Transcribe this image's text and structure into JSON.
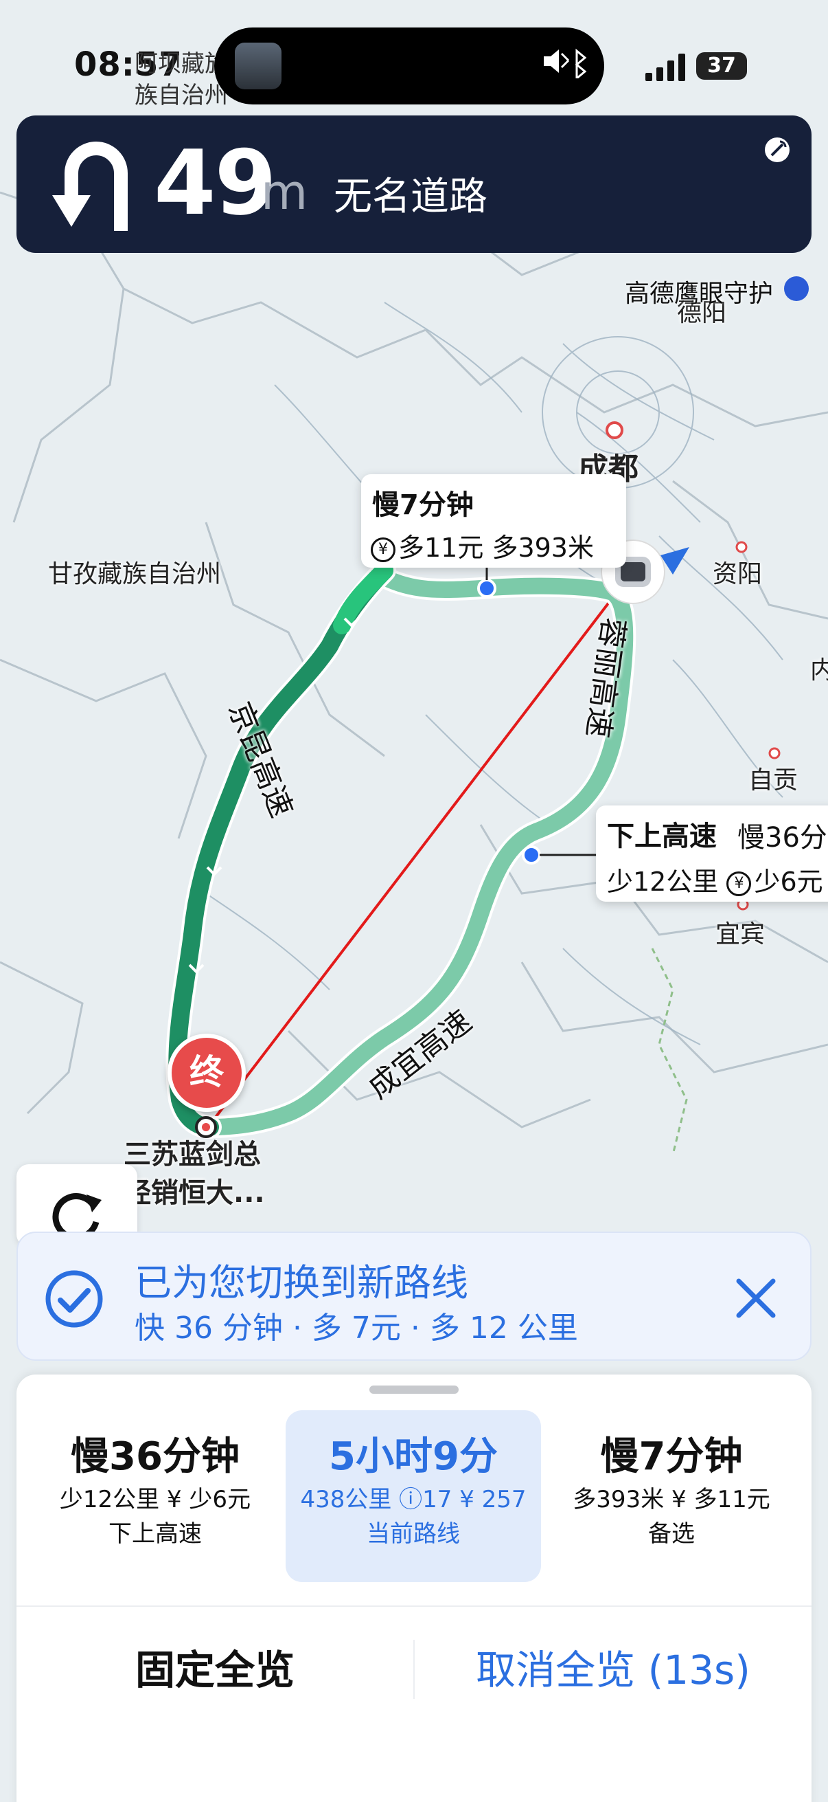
{
  "status_bar": {
    "time": "08:57",
    "overlay_text_line1": "阿坝藏族",
    "overlay_text_line2": "族自治州",
    "battery": "37"
  },
  "navigation": {
    "distance": "49",
    "unit": "m",
    "road_name": "无名道路",
    "maneuver_icon": "u-turn-left-icon"
  },
  "map": {
    "guard_label": "高德鹰眼守护",
    "cities": [
      "德阳",
      "成都",
      "资阳",
      "自贡",
      "宜宾",
      "甘孜藏族自治州",
      "内"
    ],
    "roads": {
      "jingkun": "京昆高速",
      "rongli": "蓉丽高速",
      "chengyi": "成宜高速"
    },
    "bubble_top": {
      "title": "慢7分钟",
      "fare": "多11元",
      "distance": "多393米"
    },
    "bubble_right": {
      "title": "下上高速",
      "delay": "慢36分",
      "distance": "少12公里",
      "fare": "少6元"
    },
    "end_marker": "终",
    "end_label_line1": "三苏蓝剑总",
    "end_label_line2": "经销恒大..."
  },
  "notice": {
    "title": "已为您切换到新路线",
    "subtitle": "快 36 分钟 · 多 7元 · 多 12 公里"
  },
  "routes": [
    {
      "title": "慢36分钟",
      "detail": "少12公里 ¥ 少6元",
      "label": "下上高速"
    },
    {
      "title": "5小时9分",
      "detail": "438公里 ⓘ17 ¥ 257",
      "label": "当前路线"
    },
    {
      "title": "慢7分钟",
      "detail": "多393米 ¥ 多11元",
      "label": "备选"
    }
  ],
  "actions": {
    "fix_overview": "固定全览",
    "cancel_overview": "取消全览 (13s)"
  },
  "colors": {
    "accent": "#2b6fe0",
    "route_main": "#1e8f63",
    "route_alt": "#7ccaa9",
    "nav_bg": "#16203a",
    "end_pin": "#e74b4b"
  }
}
